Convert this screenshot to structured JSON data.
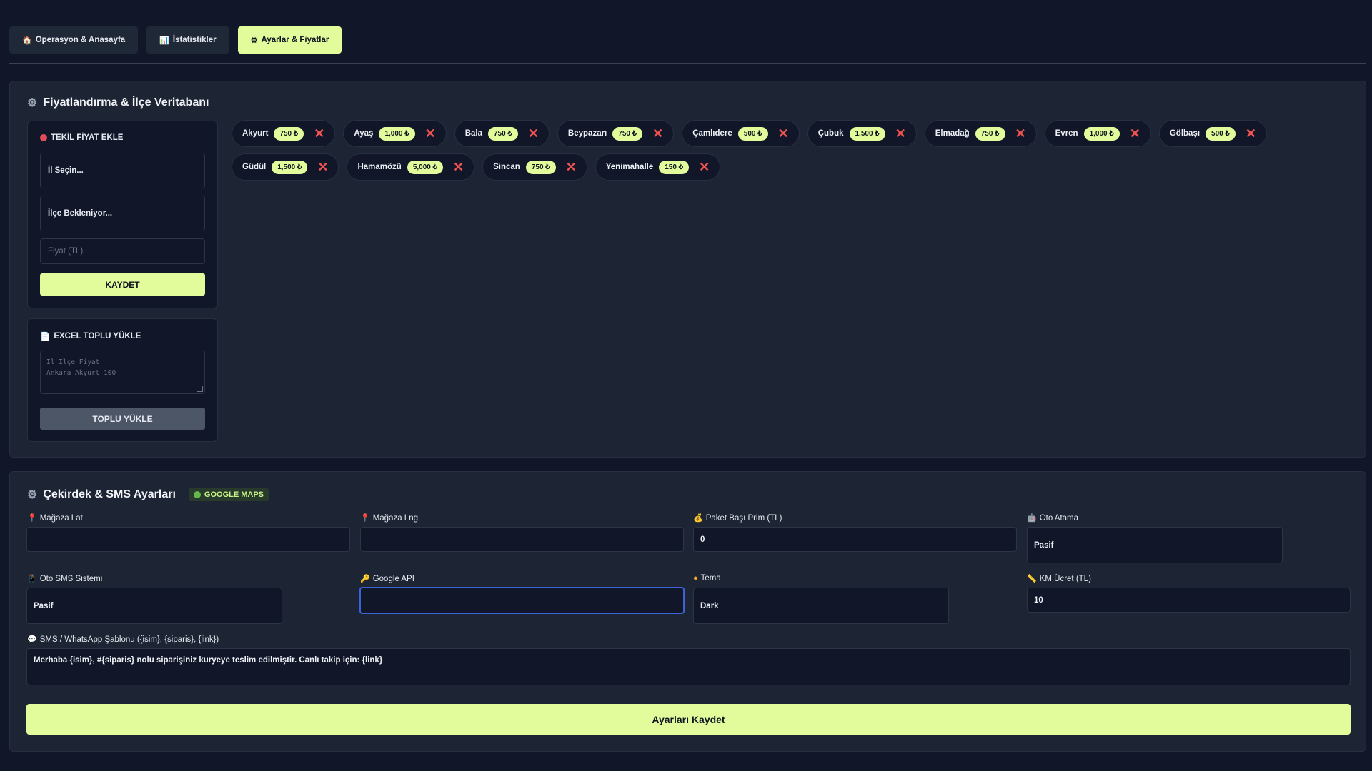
{
  "tabs": [
    {
      "icon": "🏠",
      "label": "Operasyon & Anasayfa",
      "active": false
    },
    {
      "icon": "📊",
      "label": "İstatistikler",
      "active": false
    },
    {
      "icon": "⚙",
      "label": "Ayarlar & Fiyatlar",
      "active": true
    }
  ],
  "pricing": {
    "title": "Fiyatlandırma & İlçe Veritabanı",
    "single": {
      "title": "TEKİL FİYAT EKLE",
      "province": "İl Seçin...",
      "district": "İlçe Bekleniyor...",
      "price_placeholder": "Fiyat (TL)",
      "save": "KAYDET"
    },
    "excel": {
      "title": "EXCEL TOPLU YÜKLE",
      "placeholder_line1": "İl İlçe Fiyat",
      "placeholder_line2": "Ankara Akyurt 100",
      "upload": "TOPLU YÜKLE"
    },
    "districts": [
      {
        "name": "Akyurt",
        "price": "750 ₺"
      },
      {
        "name": "Ayaş",
        "price": "1,000 ₺"
      },
      {
        "name": "Bala",
        "price": "750 ₺"
      },
      {
        "name": "Beypazarı",
        "price": "750 ₺"
      },
      {
        "name": "Çamlıdere",
        "price": "500 ₺"
      },
      {
        "name": "Çubuk",
        "price": "1,500 ₺"
      },
      {
        "name": "Elmadağ",
        "price": "750 ₺"
      },
      {
        "name": "Evren",
        "price": "1,000 ₺"
      },
      {
        "name": "Gölbaşı",
        "price": "500 ₺"
      },
      {
        "name": "Güdül",
        "price": "1,500 ₺"
      },
      {
        "name": "Hamamözü",
        "price": "5,000 ₺"
      },
      {
        "name": "Sincan",
        "price": "750 ₺"
      },
      {
        "name": "Yenimahalle",
        "price": "150 ₺"
      }
    ]
  },
  "core": {
    "title": "Çekirdek & SMS Ayarları",
    "badge": "GOOGLE MAPS",
    "fields": {
      "store_lat": {
        "label": "Mağaza Lat",
        "value": ""
      },
      "store_lng": {
        "label": "Mağaza Lng",
        "value": ""
      },
      "package_bonus": {
        "label": "Paket Başı Prim (TL)",
        "value": "0"
      },
      "auto_assign": {
        "label": "Oto Atama",
        "value": "Pasif"
      },
      "auto_sms": {
        "label": "Oto SMS Sistemi",
        "value": "Pasif"
      },
      "google_api": {
        "label": "Google API",
        "value": ""
      },
      "theme": {
        "label": "Tema",
        "value": "Dark"
      },
      "km_fee": {
        "label": "KM Ücret (TL)",
        "value": "10"
      },
      "sms_template": {
        "label": "SMS / WhatsApp Şablonu ({isim}, {siparis}, {link})",
        "value": "Merhaba {isim}, #{siparis} nolu siparişiniz kuryeye teslim edilmiştir. Canlı takip için: {link}"
      }
    },
    "save": "Ayarları Kaydet"
  }
}
